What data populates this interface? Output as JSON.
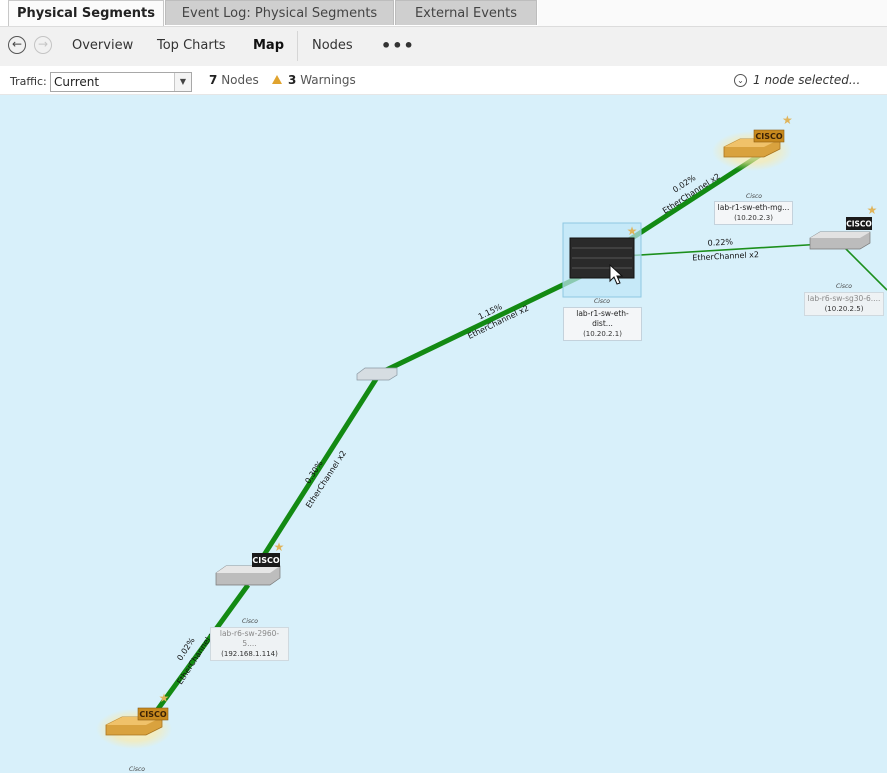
{
  "tabs": [
    {
      "label": "Physical Segments"
    },
    {
      "label": "Event Log: Physical Segments"
    },
    {
      "label": "External Events"
    }
  ],
  "toolbar": {
    "back_icon": "arrow-left-icon",
    "forward_icon": "arrow-right-icon",
    "items": [
      "Overview",
      "Top Charts",
      "Map",
      "Nodes"
    ],
    "active": "Map",
    "more_icon": "ellipsis-icon"
  },
  "filter": {
    "traffic_label": "Traffic:",
    "traffic_value": "Current",
    "nodes_count": "7",
    "nodes_label": "Nodes",
    "warnings_count": "3",
    "warnings_label": "Warnings",
    "selection_text": "1 node selected..."
  },
  "colors": {
    "map_bg": "#d8f0fa",
    "link": "#138a13",
    "warning": "#e0a32e",
    "star": "#e0b45a"
  },
  "nodes": [
    {
      "vendor": "Cisco",
      "name": "lab-r1-sw-eth-mg...",
      "ip": "(10.20.2.3)"
    },
    {
      "vendor": "Cisco",
      "name": "lab-r1-sw-eth-dist...",
      "ip": "(10.20.2.1)"
    },
    {
      "vendor": "Cisco",
      "name": "lab-r6-sw-sg30-6....",
      "ip": "(10.20.2.5)"
    },
    {
      "vendor": "Cisco",
      "name": "lab-r6-sw-2960-5....",
      "ip": "(192.168.1.114)"
    },
    {
      "vendor": "Cisco"
    }
  ],
  "links": [
    {
      "pct": "0.02%",
      "type": "EtherChannel x2"
    },
    {
      "pct": "0.22%",
      "type": "EtherChannel x2"
    },
    {
      "pct": "1.15%",
      "type": "EtherChannel x2"
    },
    {
      "pct": "0.30%",
      "type": "EtherChannel x2"
    },
    {
      "pct": "0.02%",
      "type": "EtherChannel x2"
    }
  ],
  "brand": "CISCO"
}
